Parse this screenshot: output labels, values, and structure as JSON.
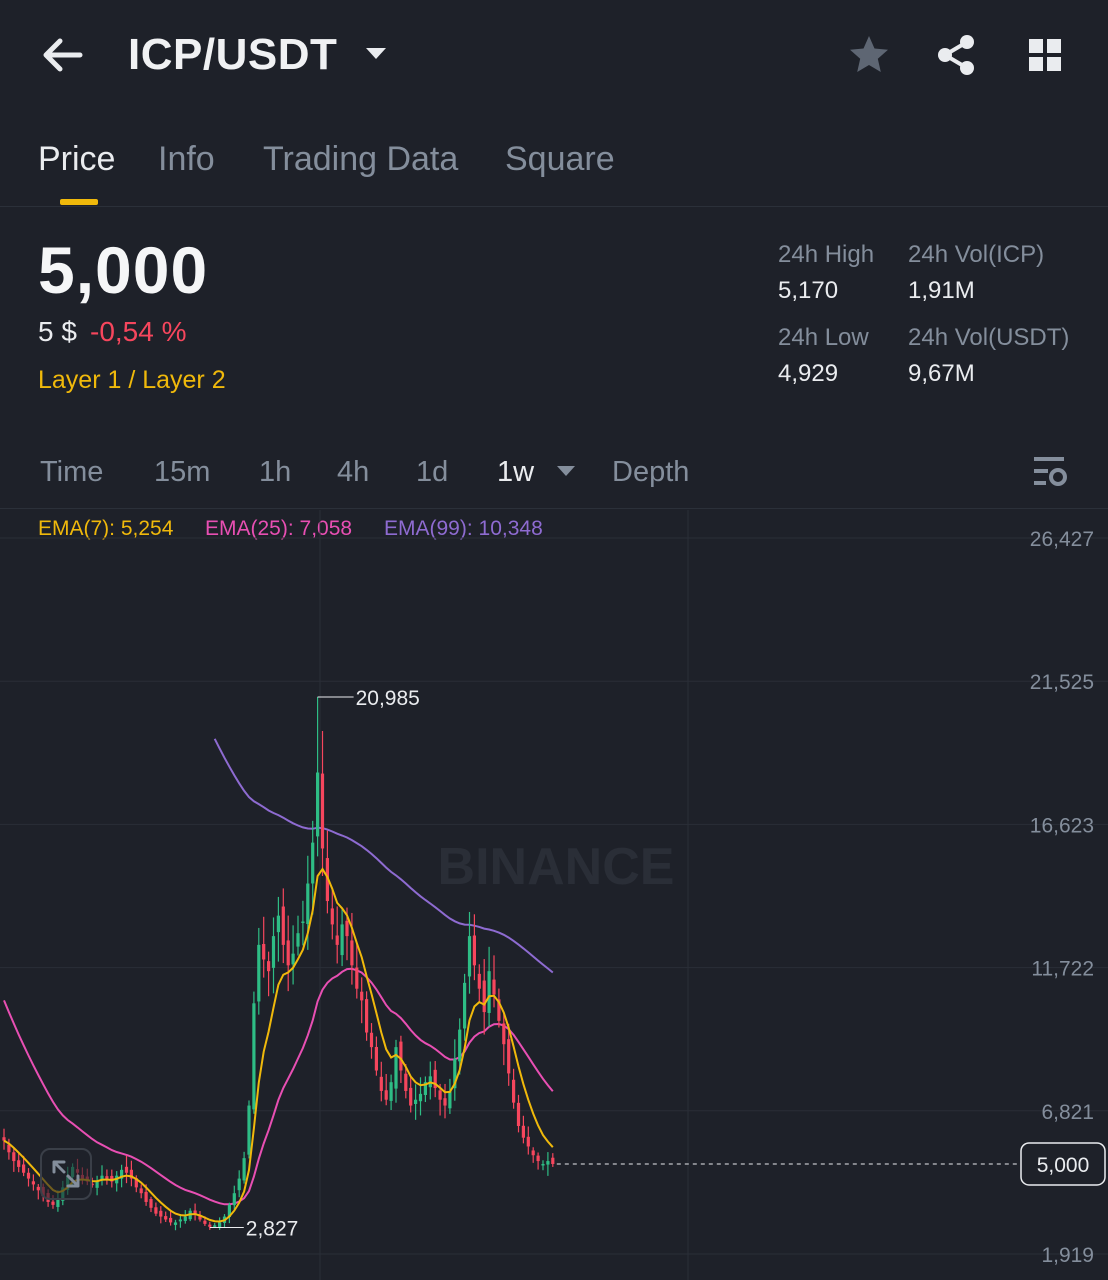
{
  "header": {
    "pair": "ICP/USDT"
  },
  "tabs": [
    {
      "label": "Price",
      "active": true
    },
    {
      "label": "Info"
    },
    {
      "label": "Trading Data"
    },
    {
      "label": "Square"
    }
  ],
  "ticker": {
    "last_price": "5,000",
    "fiat_price": "5 $",
    "change_pct": "-0,54 %",
    "category": "Layer 1 / Layer 2",
    "high_label": "24h High",
    "high_value": "5,170",
    "low_label": "24h Low",
    "low_value": "4,929",
    "vol_icp_label": "24h Vol(ICP)",
    "vol_icp_value": "1,91M",
    "vol_usdt_label": "24h Vol(USDT)",
    "vol_usdt_value": "9,67M"
  },
  "intervals": [
    {
      "label": "Time"
    },
    {
      "label": "15m"
    },
    {
      "label": "1h"
    },
    {
      "label": "4h"
    },
    {
      "label": "1d"
    },
    {
      "label": "1w",
      "active": true
    },
    {
      "label": "Depth"
    }
  ],
  "ema_legend": {
    "ema7": "EMA(7): 5,254",
    "ema25": "EMA(25): 7,058",
    "ema99": "EMA(99): 10,348"
  },
  "colors": {
    "up": "#2ebd85",
    "down": "#f6465d",
    "ema7": "#f0b90b",
    "ema25": "#e84fb3",
    "ema99": "#8e6bd1",
    "accent": "#f0b90b"
  },
  "chart_data": {
    "type": "candlestick",
    "watermark": "BINANCE",
    "y_ticks": [
      "26,427",
      "21,525",
      "16,623",
      "11,722",
      "6,821",
      "1,919"
    ],
    "y_tick_values": [
      26427,
      21525,
      16623,
      11722,
      6821,
      1919
    ],
    "current_price_label": "5,000",
    "current_price": 5000,
    "high_marker": {
      "label": "20,985",
      "value": 20985
    },
    "low_marker": {
      "label": "2,827",
      "value": 2827
    },
    "close_series": [
      5800,
      5400,
      5100,
      4900,
      4700,
      4500,
      4300,
      4100,
      3900,
      3700,
      3600,
      3800,
      4200,
      4600,
      4900,
      4700,
      4500,
      4400,
      4300,
      4400,
      4600,
      4500,
      4400,
      4600,
      4800,
      4700,
      4500,
      4200,
      4000,
      3700,
      3500,
      3300,
      3200,
      3100,
      3000,
      3000,
      3100,
      3200,
      3400,
      3300,
      3100,
      2950,
      2850,
      2900,
      3000,
      3200,
      3600,
      4000,
      4500,
      5200,
      7000,
      10500,
      12500,
      12000,
      11600,
      12800,
      13500,
      12500,
      11800,
      12200,
      12900,
      13300,
      14600,
      16000,
      18400,
      15800,
      14000,
      13200,
      12500,
      13200,
      12800,
      11800,
      11000,
      10600,
      9500,
      9000,
      8200,
      7500,
      7200,
      7800,
      9000,
      8200,
      7500,
      7000,
      7200,
      7400,
      7800,
      8000,
      7600,
      7200,
      7000,
      7500,
      8600,
      9600,
      11200,
      12800,
      11800,
      11000,
      10200,
      11600,
      10800,
      9900,
      9100,
      8100,
      7100,
      6300,
      5900,
      5600,
      5300,
      5100,
      5000,
      5100,
      5000
    ]
  }
}
